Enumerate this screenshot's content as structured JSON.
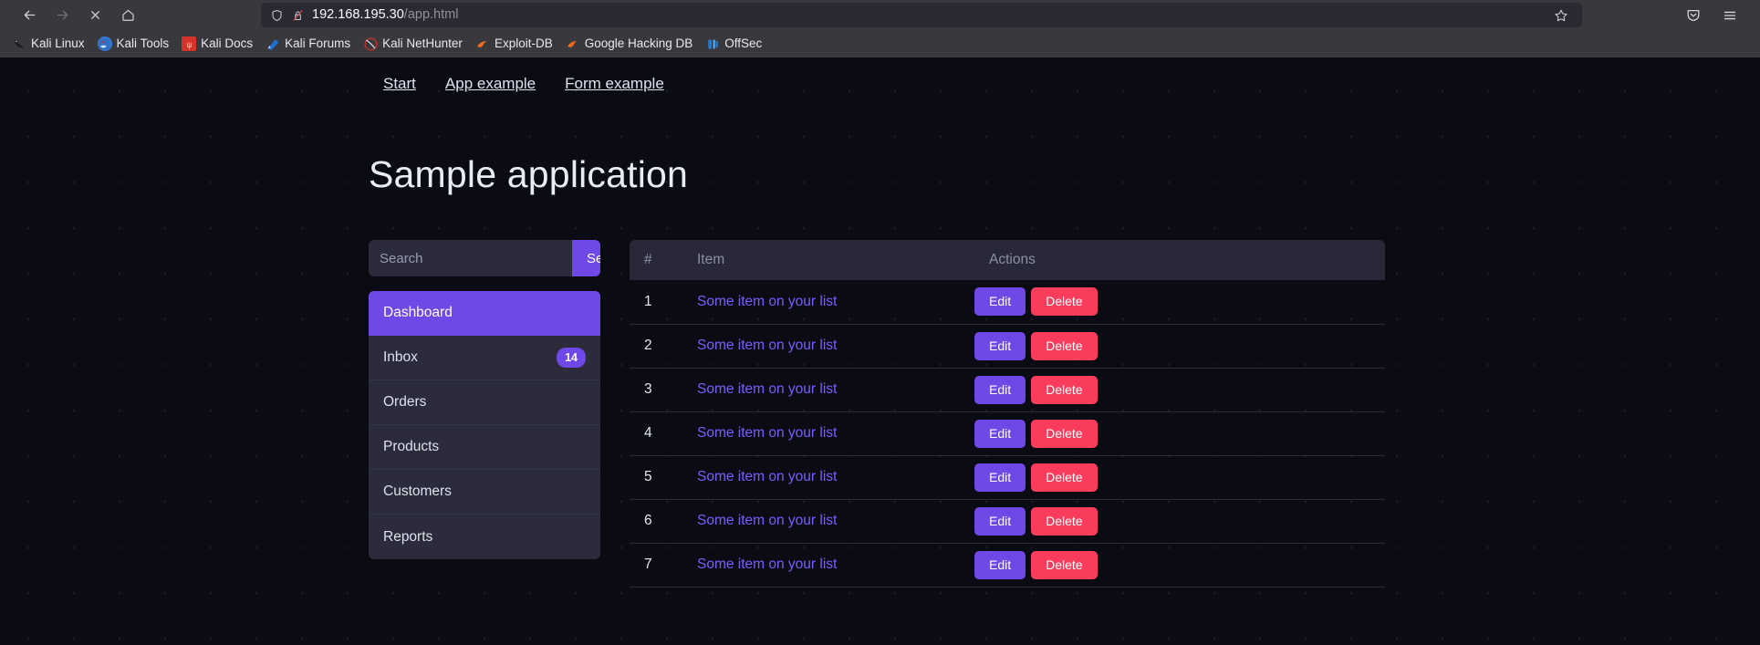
{
  "browser": {
    "toolbar": {
      "back_icon": "back-arrow-icon",
      "forward_icon": "forward-arrow-icon",
      "stop_icon": "stop-loading-icon",
      "home_icon": "home-icon",
      "shield_icon": "shield-icon",
      "lock_icon": "lock-crossed-out-icon",
      "bookmark_star_icon": "star-icon",
      "pocket_icon": "save-to-pocket-icon",
      "menu_icon": "hamburger-menu-icon",
      "url_host": "192.168.195.30",
      "url_path": "/app.html"
    },
    "bookmarks": [
      {
        "label": "Kali Linux",
        "icon": "kali-dragon-icon",
        "color": "#1b1b22"
      },
      {
        "label": "Kali Tools",
        "icon": "kali-tools-icon",
        "color": "#3a7bd5"
      },
      {
        "label": "Kali Docs",
        "icon": "kali-docs-icon",
        "color": "#e03131"
      },
      {
        "label": "Kali Forums",
        "icon": "kali-forums-icon",
        "color": "#1971c2"
      },
      {
        "label": "Kali NetHunter",
        "icon": "kali-nethunter-icon",
        "color": "#c92a2a"
      },
      {
        "label": "Exploit-DB",
        "icon": "exploit-db-icon",
        "color": "#f76707"
      },
      {
        "label": "Google Hacking DB",
        "icon": "google-hacking-db-icon",
        "color": "#f76707"
      },
      {
        "label": "OffSec",
        "icon": "offsec-icon",
        "color": "#1c7ed6"
      }
    ]
  },
  "page": {
    "nav_links": [
      {
        "label": "Start"
      },
      {
        "label": "App example"
      },
      {
        "label": "Form example"
      }
    ],
    "title": "Sample application",
    "search": {
      "placeholder": "Search",
      "value": "",
      "button_label": "Search"
    },
    "sidebar": [
      {
        "label": "Dashboard",
        "badge": "",
        "active": true
      },
      {
        "label": "Inbox",
        "badge": "14",
        "active": false
      },
      {
        "label": "Orders",
        "badge": "",
        "active": false
      },
      {
        "label": "Products",
        "badge": "",
        "active": false
      },
      {
        "label": "Customers",
        "badge": "",
        "active": false
      },
      {
        "label": "Reports",
        "badge": "",
        "active": false
      }
    ],
    "table": {
      "headers": {
        "num": "#",
        "item": "Item",
        "actions": "Actions"
      },
      "edit_label": "Edit",
      "delete_label": "Delete",
      "rows": [
        {
          "num": "1",
          "item": "Some item on your list"
        },
        {
          "num": "2",
          "item": "Some item on your list"
        },
        {
          "num": "3",
          "item": "Some item on your list"
        },
        {
          "num": "4",
          "item": "Some item on your list"
        },
        {
          "num": "5",
          "item": "Some item on your list"
        },
        {
          "num": "6",
          "item": "Some item on your list"
        },
        {
          "num": "7",
          "item": "Some item on your list"
        }
      ]
    },
    "colors": {
      "accent_purple": "#7048e8",
      "link_purple": "#7c5cff",
      "danger_red": "#fa3c5c",
      "background": "#0b0b14",
      "panel": "#2b2b3b",
      "table_header": "#282838"
    }
  }
}
